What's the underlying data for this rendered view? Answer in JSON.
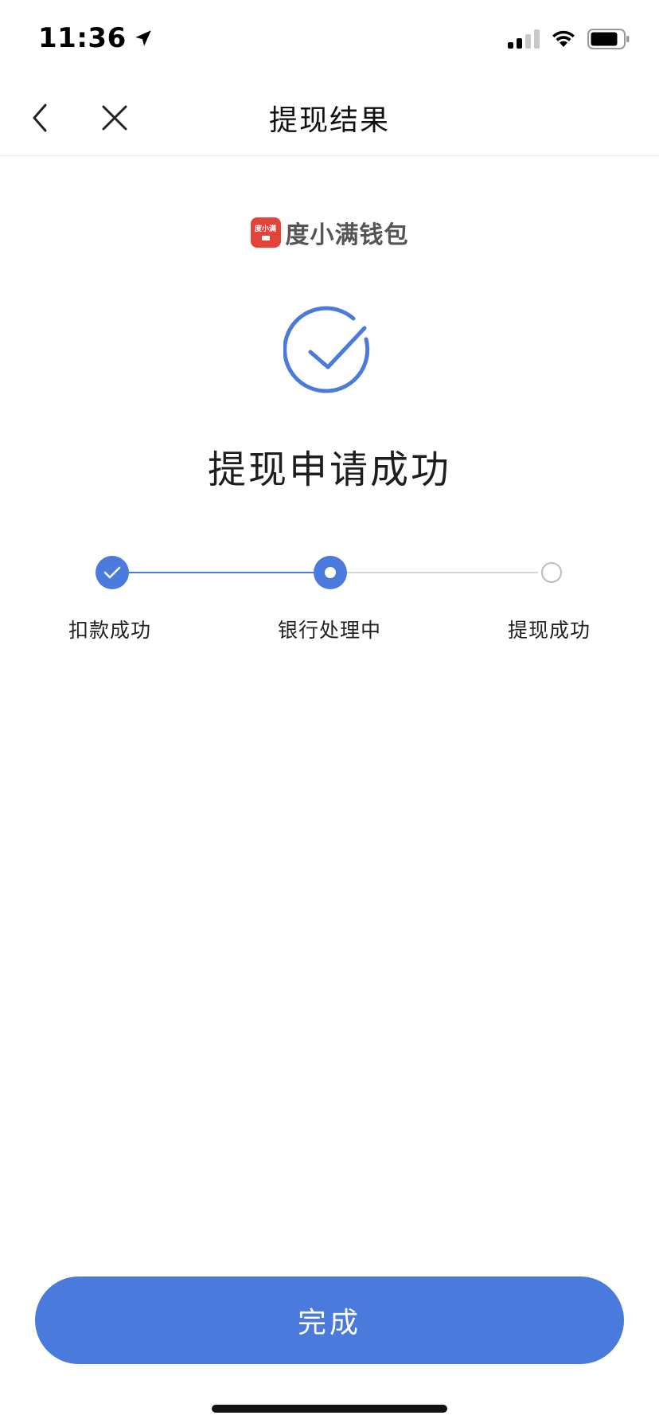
{
  "status_bar": {
    "time": "11:36",
    "icons": [
      "location-arrow-icon",
      "signal-icon",
      "wifi-icon",
      "battery-icon"
    ]
  },
  "nav": {
    "title": "提现结果",
    "back_icon": "chevron-left-icon",
    "close_icon": "close-icon"
  },
  "brand": {
    "name": "度小满钱包",
    "logo_text": "度小满",
    "color": "#e4433a"
  },
  "result": {
    "icon": "check-circle-icon",
    "title": "提现申请成功"
  },
  "steps": [
    {
      "label": "扣款成功",
      "state": "done"
    },
    {
      "label": "银行处理中",
      "state": "current"
    },
    {
      "label": "提现成功",
      "state": "pending"
    }
  ],
  "footer": {
    "done_label": "完成"
  },
  "colors": {
    "accent": "#4a7bdc",
    "inactive": "#d6d6d6"
  }
}
